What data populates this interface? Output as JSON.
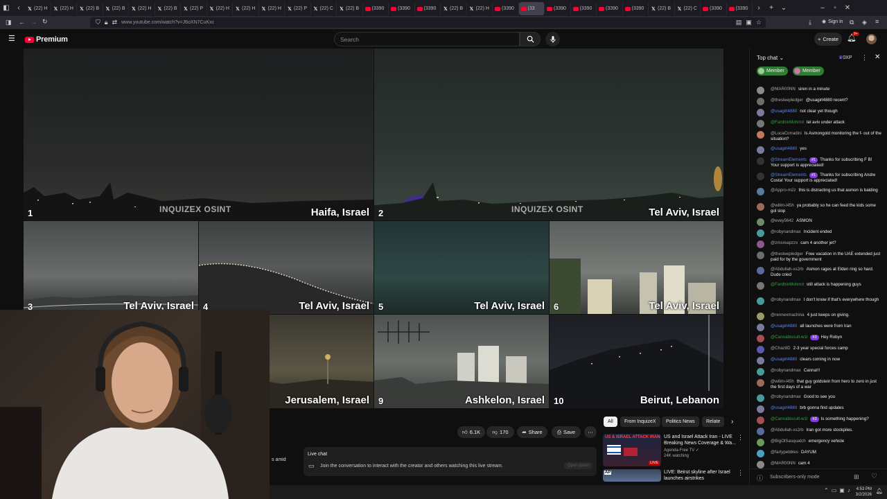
{
  "browser": {
    "tabs": [
      {
        "icon": "x",
        "title": "(22) H"
      },
      {
        "icon": "x",
        "title": "(22) H"
      },
      {
        "icon": "x",
        "title": "(22) B"
      },
      {
        "icon": "x",
        "title": "(22) B"
      },
      {
        "icon": "x",
        "title": "(22) H"
      },
      {
        "icon": "x",
        "title": "(22) B"
      },
      {
        "icon": "x",
        "title": "(22) P"
      },
      {
        "icon": "x",
        "title": "(22) H"
      },
      {
        "icon": "x",
        "title": "(22) H"
      },
      {
        "icon": "x",
        "title": "(22) H"
      },
      {
        "icon": "x",
        "title": "(22) P"
      },
      {
        "icon": "x",
        "title": "(22) C"
      },
      {
        "icon": "x",
        "title": "(22) B"
      },
      {
        "icon": "yt",
        "title": "(3390"
      },
      {
        "icon": "yt",
        "title": "(3390"
      },
      {
        "icon": "yt",
        "title": "(3390"
      },
      {
        "icon": "x",
        "title": "(22) B"
      },
      {
        "icon": "x",
        "title": "(22) H"
      },
      {
        "icon": "yt",
        "title": "(3390"
      },
      {
        "icon": "yt",
        "title": "(33"
      },
      {
        "icon": "yt",
        "title": "(3390"
      },
      {
        "icon": "yt",
        "title": "(3390"
      },
      {
        "icon": "yt",
        "title": "(3390"
      },
      {
        "icon": "yt",
        "title": "(3390"
      },
      {
        "icon": "x",
        "title": "(22) B"
      },
      {
        "icon": "x",
        "title": "(22) C"
      },
      {
        "icon": "yt",
        "title": "(3390"
      },
      {
        "icon": "yt",
        "title": "(3390"
      }
    ],
    "active_tab_index": 19,
    "url": "www.youtube.com/watch?v=J6oXN7CuKxc",
    "sign_in": "Sign in"
  },
  "youtube": {
    "brand": "Premium",
    "search_placeholder": "Search",
    "create_label": "Create",
    "notification_count": "9+"
  },
  "video": {
    "watermark": "INQUIZEX OSINT",
    "cams": [
      {
        "num": "1",
        "label": "Haifa, Israel"
      },
      {
        "num": "2",
        "label": "Tel Aviv, Israel"
      },
      {
        "num": "3",
        "label": "Tel Aviv, Israel"
      },
      {
        "num": "4",
        "label": "Tel Aviv, Israel"
      },
      {
        "num": "5",
        "label": "Tel Aviv, Israel"
      },
      {
        "num": "6",
        "label": "Tel Aviv, Israel"
      },
      {
        "num": "",
        "label": "Jerusalem, Israel"
      },
      {
        "num": "9",
        "label": "Ashkelon, Israel"
      },
      {
        "num": "10",
        "label": "Beirut, Lebanon"
      }
    ]
  },
  "under_video": {
    "like_count": "6.1K",
    "dislike_count": "170",
    "share_label": "Share",
    "save_label": "Save",
    "desc_fragment": "s amid",
    "live_chat": {
      "title": "Live chat",
      "text": "Join the conversation to interact with the creator and others watching this live stream.",
      "open_label": "Open panel"
    }
  },
  "recommendations": {
    "chips": [
      "All",
      "From InquizeX",
      "Politics News",
      "Relate"
    ],
    "items": [
      {
        "thumb_text": "US & ISRAEL ATTACK IRAN",
        "badge": "LIVE",
        "title": "US and Israel Attack Iran - LIVE Breaking News Coverage & Wa...",
        "channel": "Agenda-Free TV",
        "meta": "24K watching"
      },
      {
        "thumb_text": "AP",
        "badge": "",
        "title": "LIVE: Beirut skyline after Israel launches airstrikes",
        "channel": "",
        "meta": ""
      }
    ]
  },
  "chat": {
    "mode": "Top chat",
    "points": "0XP",
    "member_chips": [
      "Member",
      "Member"
    ],
    "messages": [
      {
        "author": "@MAR00NN",
        "role": "",
        "badge": "",
        "text": "siren in a minute",
        "color": "#8a8a8a"
      },
      {
        "author": "@thesleepledger",
        "role": "",
        "badge": "",
        "text": "@usagirl4880 recent?",
        "color": "#6d6d6d"
      },
      {
        "author": "@usagirl4880",
        "role": "mod",
        "badge": "",
        "text": "not clear yet though",
        "color": "#7a7a9a"
      },
      {
        "author": "@FardhinMohmd",
        "role": "mem",
        "badge": "",
        "text": "tel aviv under attack",
        "color": "#777"
      },
      {
        "author": "@LucaCorradini",
        "role": "",
        "badge": "",
        "text": "Is Asmongold monitoring the f- out of the situation?",
        "color": "#c07a5a"
      },
      {
        "author": "@usagirl4880",
        "role": "mod",
        "badge": "",
        "text": "yes",
        "color": "#7a7a9a"
      },
      {
        "author": "@StreamElements",
        "role": "mod",
        "badge": "#1",
        "text": "Thanks for subscribing F B! Your support is appreciated!",
        "color": "#333"
      },
      {
        "author": "@StreamElements",
        "role": "mod",
        "badge": "#1",
        "text": "Thanks for subscribing Andre Costa! Your support is appreciated!",
        "color": "#333"
      },
      {
        "author": "@Appro-m2z",
        "role": "",
        "badge": "",
        "text": "this is distracting us that asmon is balding",
        "color": "#5a7a9a"
      },
      {
        "author": "@willm-l45h",
        "role": "",
        "badge": "",
        "text": "ya probably so he can feed the kids some gol slop",
        "color": "#9a6a5a"
      },
      {
        "author": "@evey5642",
        "role": "",
        "badge": "",
        "text": "ASMON",
        "color": "#6a8a6a"
      },
      {
        "author": "@robynandmax",
        "role": "",
        "badge": "",
        "text": "Incident ended",
        "color": "#4a9a9a"
      },
      {
        "author": "@zmsreapzzx",
        "role": "",
        "badge": "",
        "text": "cam 4 another jet?",
        "color": "#8a5a8a"
      },
      {
        "author": "@thesleepledger",
        "role": "",
        "badge": "",
        "text": "Free vacation in the UAE extended just paid for by the government",
        "color": "#6d6d6d"
      },
      {
        "author": "@Abdullah-xs2rb",
        "role": "",
        "badge": "",
        "text": "Asmon rages at Elden ring so hard. Dude cried",
        "color": "#5a6a9a"
      },
      {
        "author": "@FardhinMohmd",
        "role": "mem",
        "badge": "",
        "text": "still attack is happening guys",
        "color": "#777"
      },
      {
        "author": "@robynandmax",
        "role": "",
        "badge": "",
        "text": "I don't know if that's everywhere though",
        "color": "#4a9a9a"
      },
      {
        "author": "@rennexmachina",
        "role": "",
        "badge": "",
        "text": "4 just keeps on giving.",
        "color": "#9a9a6a"
      },
      {
        "author": "@usagirl4880",
        "role": "mod",
        "badge": "",
        "text": "all launches were from Iran",
        "color": "#7a7a9a"
      },
      {
        "author": "@Cannabiscult-w1l",
        "role": "mem",
        "badge": "#3",
        "text": "Hey Robyn",
        "color": "#a05050"
      },
      {
        "author": "@Chaz8D",
        "role": "",
        "badge": "",
        "text": "2-3 year special forces camp",
        "color": "#5a5aaa"
      },
      {
        "author": "@usagirl4880",
        "role": "mod",
        "badge": "",
        "text": "clears coming in now",
        "color": "#7a7a9a"
      },
      {
        "author": "@robynandmax",
        "role": "",
        "badge": "",
        "text": "Canna!!!",
        "color": "#4a9a9a"
      },
      {
        "author": "@willm-l45h",
        "role": "",
        "badge": "",
        "text": "that guy goldstein from hero to zero in just the first days of a war",
        "color": "#9a6a5a"
      },
      {
        "author": "@robynandmax",
        "role": "",
        "badge": "",
        "text": "Good to see you",
        "color": "#4a9a9a"
      },
      {
        "author": "@usagirl4880",
        "role": "mod",
        "badge": "",
        "text": "brb gonna find updates",
        "color": "#7a7a9a"
      },
      {
        "author": "@Cannabiscult-w1l",
        "role": "mem",
        "badge": "#3",
        "text": "Is something happening?",
        "color": "#a05050"
      },
      {
        "author": "@Abdullah-xs2rb",
        "role": "",
        "badge": "",
        "text": "Iran got more stockpiles.",
        "color": "#5a6a9a"
      },
      {
        "author": "@BigOlSasquatch",
        "role": "",
        "badge": "",
        "text": "emergency vehicle",
        "color": "#6a9a5a"
      },
      {
        "author": "@fartypebbles",
        "role": "",
        "badge": "",
        "text": "DAYUM",
        "color": "#4aa0c0"
      },
      {
        "author": "@MAR00NN",
        "role": "",
        "badge": "",
        "text": "cam 4",
        "color": "#8a8a8a"
      }
    ],
    "footer_mode": "Subscribers-only mode"
  },
  "taskbar": {
    "time": "4:53 PM",
    "date": "3/2/2026"
  }
}
